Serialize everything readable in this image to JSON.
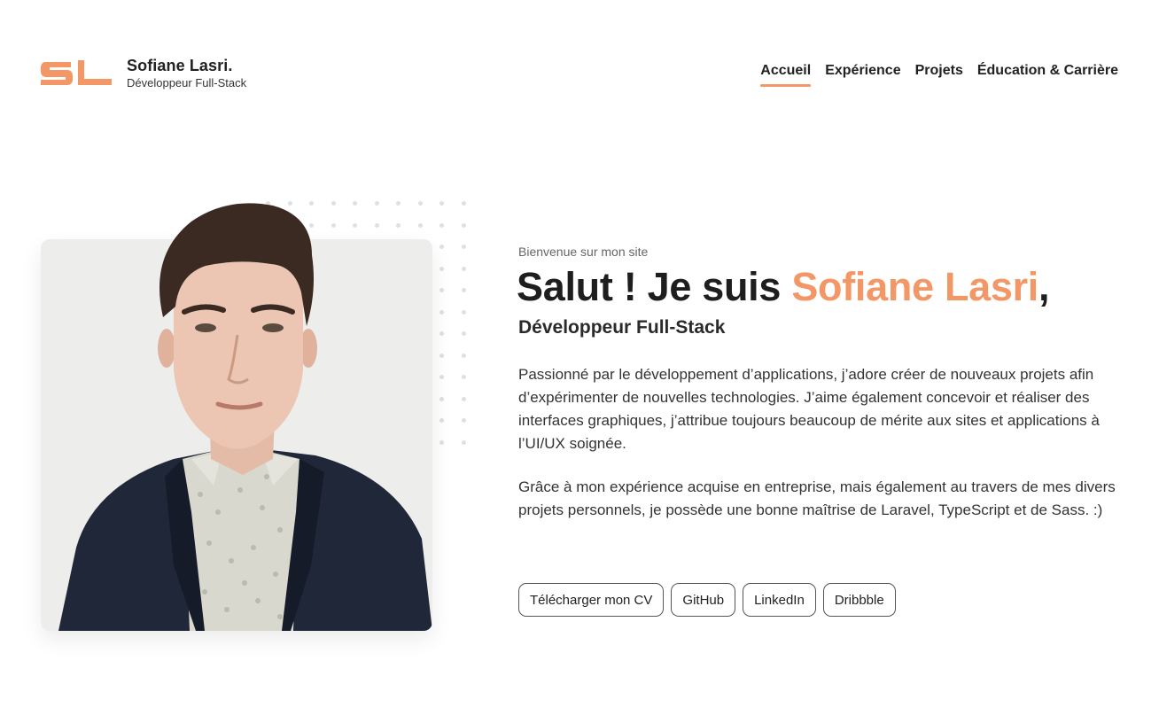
{
  "header": {
    "brand_name": "Sofiane Lasri.",
    "brand_role": "Développeur Full-Stack",
    "nav": [
      {
        "label": "Accueil",
        "active": true
      },
      {
        "label": "Expérience",
        "active": false
      },
      {
        "label": "Projets",
        "active": false
      },
      {
        "label": "Éducation & Carrière",
        "active": false
      }
    ]
  },
  "hero": {
    "welcome": "Bienvenue sur mon site",
    "headline_prefix": "Salut ! Je suis ",
    "headline_name": "Sofiane Lasri",
    "headline_suffix": ",",
    "subhead": "Développeur Full-Stack",
    "paragraphs": [
      "Passionné par le développement d’applications, j’adore créer de nouveaux projets afin d’expérimenter de nouvelles technologies. J’aime également concevoir et réaliser des interfaces graphiques, j’attribue toujours beaucoup de mérite aux sites et applications à l’UI/UX soignée.",
      "Grâce à mon expérience acquise en entreprise, mais également au travers de mes divers projets personnels, je possède une bonne maîtrise de Laravel, TypeScript et de Sass. :)"
    ],
    "buttons": [
      {
        "label": "Télécharger mon CV"
      },
      {
        "label": "GitHub"
      },
      {
        "label": "LinkedIn"
      },
      {
        "label": "Dribbble"
      }
    ]
  },
  "colors": {
    "accent": "#f39766",
    "text_dark": "#1e1e1e",
    "card_bg": "#ededeb"
  },
  "icons": {
    "logo": "sl-monogram-logo"
  }
}
